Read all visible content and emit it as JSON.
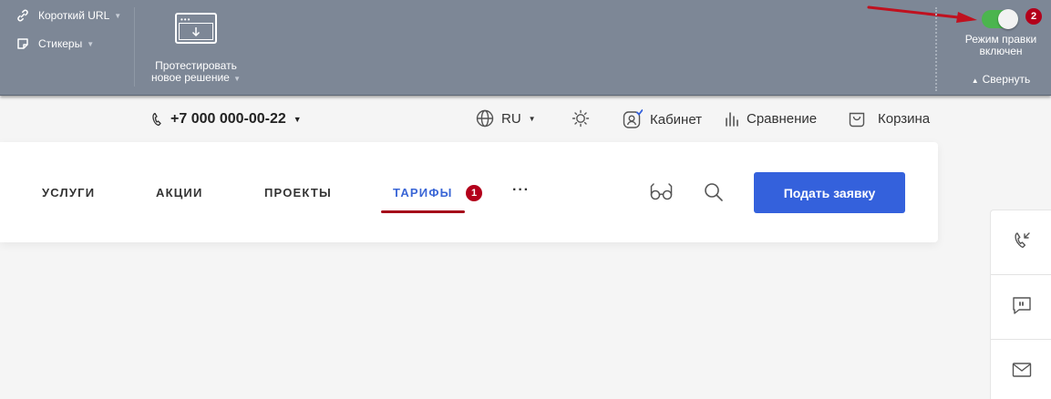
{
  "admin_panel": {
    "short_url_label": "Короткий URL",
    "stickers_label": "Стикеры",
    "test_solution_line1": "Протестировать",
    "test_solution_line2": "новое решение",
    "edit_mode_line1": "Режим правки",
    "edit_mode_line2": "включен",
    "edit_mode_badge": "2",
    "collapse_label": "Свернуть",
    "toggle_color": "#4bb54e",
    "background_color": "#7d8796"
  },
  "topline": {
    "phone": "+7 000 000-00-22",
    "language": "RU",
    "cabinet": "Кабинет",
    "compare": "Сравнение",
    "cart": "Корзина"
  },
  "menu": {
    "items": [
      {
        "label": "УСЛУГИ"
      },
      {
        "label": "АКЦИИ"
      },
      {
        "label": "ПРОЕКТЫ"
      },
      {
        "label": "ТАРИФЫ"
      }
    ],
    "active_badge": "1",
    "more_label": "···",
    "cta_label": "Подать заявку",
    "accent_color": "#3461dc",
    "badge_color": "#b3001b"
  },
  "icons": [
    "link-icon",
    "sticker-icon",
    "download-window-icon",
    "phone-icon",
    "globe-icon",
    "sun-icon",
    "user-icon",
    "bar-chart-icon",
    "bag-icon",
    "glasses-icon",
    "search-icon",
    "callback-icon",
    "chat-icon",
    "mail-icon"
  ]
}
